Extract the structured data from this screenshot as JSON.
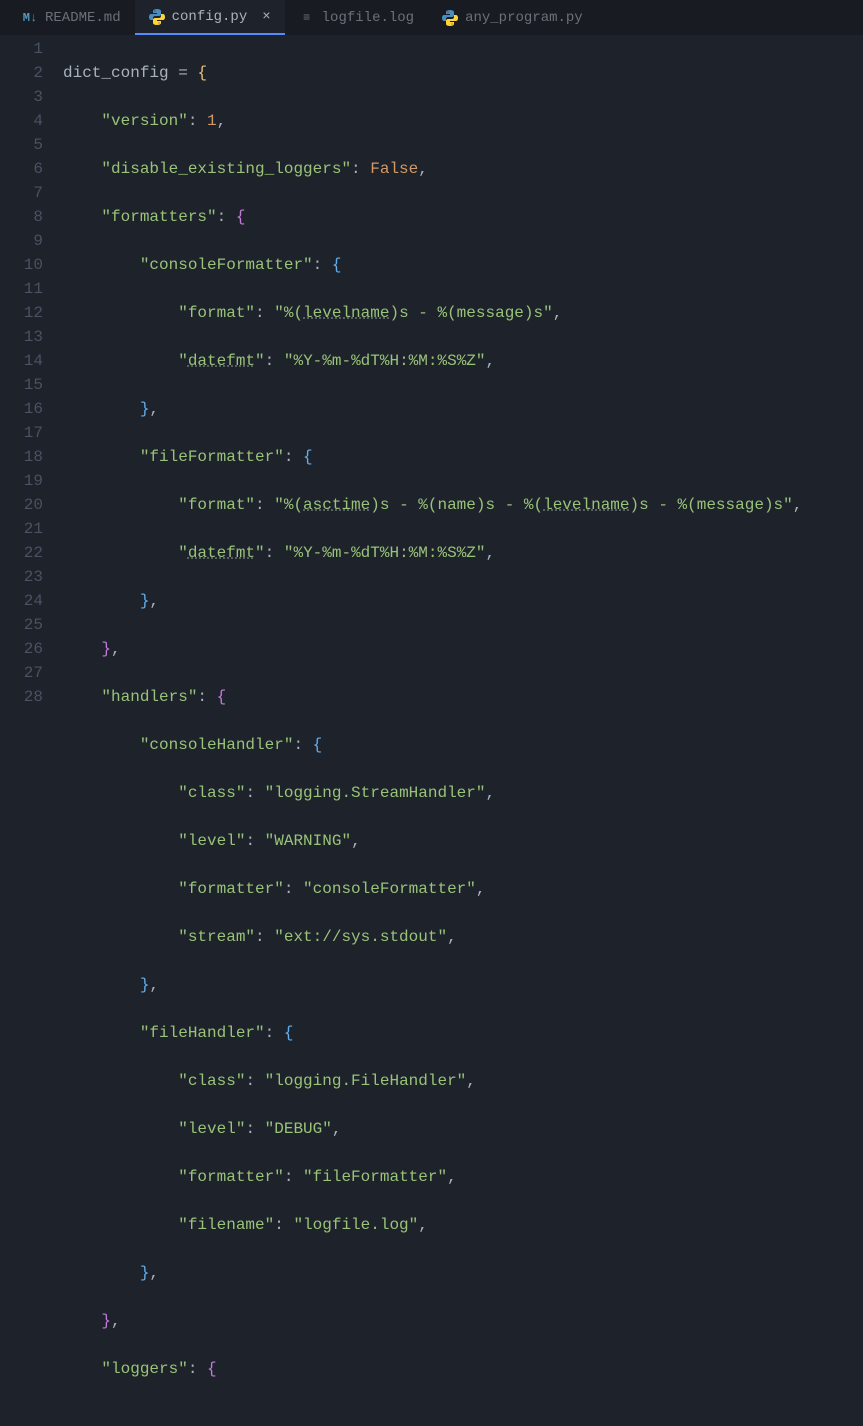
{
  "tabs": [
    {
      "icon": "M↓",
      "label": "README.md",
      "active": false,
      "close": ""
    },
    {
      "icon": "py",
      "label": "config.py",
      "active": true,
      "close": "×"
    },
    {
      "icon": "≡",
      "label": "logfile.log",
      "active": false,
      "close": ""
    },
    {
      "icon": "py",
      "label": "any_program.py",
      "active": false,
      "close": ""
    }
  ],
  "lines": [
    "1",
    "2",
    "3",
    "4",
    "5",
    "6",
    "7",
    "8",
    "9",
    "10",
    "11",
    "12",
    "13",
    "14",
    "15",
    "16",
    "17",
    "18",
    "19",
    "20",
    "21",
    "22",
    "23",
    "24",
    "25",
    "26",
    "27",
    "28"
  ],
  "code": {
    "l1": {
      "var": "dict_config",
      "op": " = ",
      "brace": "{"
    },
    "l2": {
      "indent": "    ",
      "key": "\"version\"",
      "colon": ": ",
      "val": "1",
      "comma": ","
    },
    "l3": {
      "indent": "    ",
      "key": "\"disable_existing_loggers\"",
      "colon": ": ",
      "val": "False",
      "comma": ","
    },
    "l4": {
      "indent": "    ",
      "key": "\"formatters\"",
      "colon": ": ",
      "brace": "{"
    },
    "l5": {
      "indent": "        ",
      "key": "\"consoleFormatter\"",
      "colon": ": ",
      "brace": "{"
    },
    "l6": {
      "indent": "            ",
      "key": "\"format\"",
      "colon": ": ",
      "q1": "\"",
      "p1": "%(",
      "u1": "levelname",
      "p2": ")s - %(message)s",
      "q2": "\"",
      "comma": ","
    },
    "l7": {
      "indent": "            ",
      "q1": "\"",
      "u1": "datefmt",
      "q2": "\"",
      "colon": ": ",
      "val": "\"%Y-%m-%dT%H:%M:%S%Z\"",
      "comma": ","
    },
    "l8": {
      "indent": "        ",
      "brace": "}",
      "comma": ","
    },
    "l9": {
      "indent": "        ",
      "key": "\"fileFormatter\"",
      "colon": ": ",
      "brace": "{"
    },
    "l10": {
      "indent": "            ",
      "key": "\"format\"",
      "colon": ": ",
      "q1": "\"",
      "p1": "%(",
      "u1": "asctime",
      "p2": ")s - %(name)s - %(",
      "u2": "levelname",
      "p3": ")s - %(message)s",
      "q2": "\"",
      "comma": ","
    },
    "l11": {
      "indent": "            ",
      "q1": "\"",
      "u1": "datefmt",
      "q2": "\"",
      "colon": ": ",
      "val": "\"%Y-%m-%dT%H:%M:%S%Z\"",
      "comma": ","
    },
    "l12": {
      "indent": "        ",
      "brace": "}",
      "comma": ","
    },
    "l13": {
      "indent": "    ",
      "brace": "}",
      "comma": ","
    },
    "l14": {
      "indent": "    ",
      "key": "\"handlers\"",
      "colon": ": ",
      "brace": "{"
    },
    "l15": {
      "indent": "        ",
      "key": "\"consoleHandler\"",
      "colon": ": ",
      "brace": "{"
    },
    "l16": {
      "indent": "            ",
      "key": "\"class\"",
      "colon": ": ",
      "val": "\"logging.StreamHandler\"",
      "comma": ","
    },
    "l17": {
      "indent": "            ",
      "key": "\"level\"",
      "colon": ": ",
      "val": "\"WARNING\"",
      "comma": ","
    },
    "l18": {
      "indent": "            ",
      "key": "\"formatter\"",
      "colon": ": ",
      "val": "\"consoleFormatter\"",
      "comma": ","
    },
    "l19": {
      "indent": "            ",
      "key": "\"stream\"",
      "colon": ": ",
      "val": "\"ext://sys.stdout\"",
      "comma": ","
    },
    "l20": {
      "indent": "        ",
      "brace": "}",
      "comma": ","
    },
    "l21": {
      "indent": "        ",
      "key": "\"fileHandler\"",
      "colon": ": ",
      "brace": "{"
    },
    "l22": {
      "indent": "            ",
      "key": "\"class\"",
      "colon": ": ",
      "val": "\"logging.FileHandler\"",
      "comma": ","
    },
    "l23": {
      "indent": "            ",
      "key": "\"level\"",
      "colon": ": ",
      "val": "\"DEBUG\"",
      "comma": ","
    },
    "l24": {
      "indent": "            ",
      "key": "\"formatter\"",
      "colon": ": ",
      "val": "\"fileFormatter\"",
      "comma": ","
    },
    "l25": {
      "indent": "            ",
      "key": "\"filename\"",
      "colon": ": ",
      "val": "\"logfile.log\"",
      "comma": ","
    },
    "l26": {
      "indent": "        ",
      "brace": "}",
      "comma": ","
    },
    "l27": {
      "indent": "    ",
      "brace": "}",
      "comma": ","
    },
    "l28": {
      "indent": "    ",
      "key": "\"loggers\"",
      "colon": ": ",
      "brace": "{"
    }
  }
}
